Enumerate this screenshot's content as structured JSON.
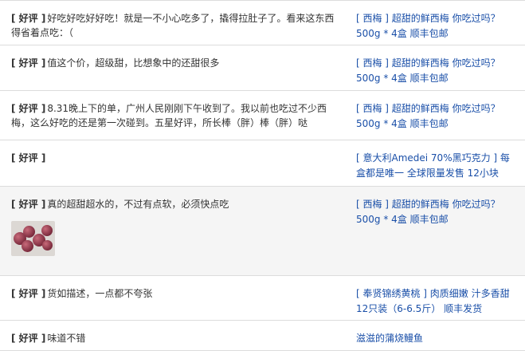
{
  "reviews": [
    {
      "tag": "[ 好评 ]",
      "text": "好吃好吃好好吃！就是一不小心吃多了，撬得拉肚子了。看来这东西得省着点吃：（",
      "product": "[ 西梅 ] 超甜的鲜西梅 你吃过吗？500g * 4盒 顺丰包邮"
    },
    {
      "tag": "[ 好评 ]",
      "text": "值这个价，超级甜，比想象中的还甜很多",
      "product": "[ 西梅 ] 超甜的鲜西梅 你吃过吗？500g * 4盒 顺丰包邮"
    },
    {
      "tag": "[ 好评 ]",
      "text": "8.31晚上下的单，广州人民刚刚下午收到了。我以前也吃过不少西梅，这么好吃的还是第一次碰到。五星好评，所长棒（胖）棒（胖）哒",
      "product": "[ 西梅 ] 超甜的鲜西梅 你吃过吗？500g * 4盒 顺丰包邮"
    },
    {
      "tag": "[ 好评 ]",
      "text": "",
      "product": "[ 意大利Amedei 70%黑巧克力 ] 每盒都是唯一 全球限量发售 12小块"
    },
    {
      "tag": "[ 好评 ]",
      "text": "真的超甜超水的，不过有点软，必须快点吃",
      "product": "[ 西梅 ] 超甜的鲜西梅 你吃过吗？500g * 4盒 顺丰包邮"
    },
    {
      "tag": "[ 好评 ]",
      "text": "货如描述，一点都不夸张",
      "product": "[ 奉贤锦绣黄桃 ] 肉质细嫩 汁多香甜 12只装（6-6.5斤） 顺丰发货"
    },
    {
      "tag": "[ 好评 ]",
      "text": "味道不错",
      "product": "滋滋的蒲烧鳗鱼"
    }
  ],
  "colors": {
    "link": "#1a4fa8",
    "divider": "#dcdcdc",
    "highlight_row": "#f5f5f5"
  }
}
